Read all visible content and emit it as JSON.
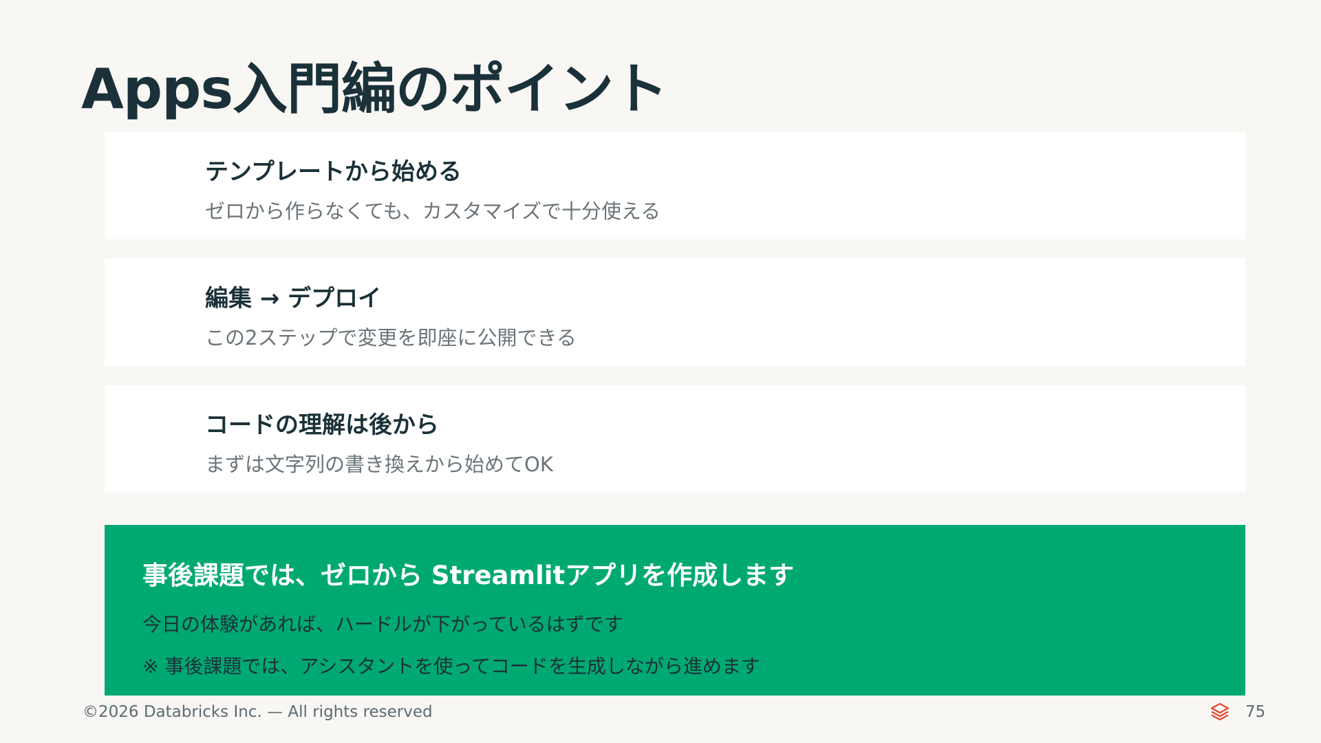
{
  "slide": {
    "title": "Apps入門編のポイント",
    "cards": [
      {
        "heading": "テンプレートから始める",
        "description": "ゼロから作らなくても、カスタマイズで十分使える"
      },
      {
        "heading": "編集 → デプロイ",
        "description": "この2ステップで変更を即座に公開できる"
      },
      {
        "heading": "コードの理解は後から",
        "description": "まずは文字列の書き換えから始めてOK"
      }
    ],
    "callout": {
      "heading": "事後課題では、ゼロから Streamlitアプリを作成します",
      "line1": "今日の体験があれば、ハードルが下がっているはずです",
      "line2": "※ 事後課題では、アシスタントを使ってコードを生成しながら進めます"
    }
  },
  "footer": {
    "copyright": "©2026 Databricks Inc. — All rights reserved",
    "logo_icon": "databricks-logo-icon",
    "page_number": "75"
  },
  "colors": {
    "background": "#f9f7f4",
    "card_background": "#ffffff",
    "callout_background": "#00a972",
    "title_text": "#1b3139",
    "muted_text": "#6b7479",
    "logo": "#e8442f"
  }
}
